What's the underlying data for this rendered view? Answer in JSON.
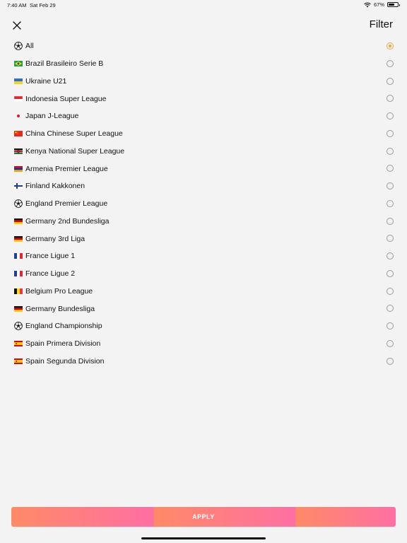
{
  "status_bar": {
    "time": "7:40 AM",
    "date": "Sat Feb 29",
    "battery_text": "67%",
    "battery_level": 0.67
  },
  "header": {
    "title": "Filter",
    "close_icon": "close-icon"
  },
  "leagues": [
    {
      "label": "All",
      "icon": "soccer-ball",
      "selected": true
    },
    {
      "label": "Brazil Brasileiro Serie B",
      "icon": "flag-brazil",
      "selected": false
    },
    {
      "label": "Ukraine U21",
      "icon": "flag-ukraine",
      "selected": false
    },
    {
      "label": "Indonesia Super League",
      "icon": "flag-indonesia",
      "selected": false
    },
    {
      "label": "Japan J-League",
      "icon": "flag-japan",
      "selected": false
    },
    {
      "label": "China Chinese Super League",
      "icon": "flag-china",
      "selected": false
    },
    {
      "label": "Kenya National Super League",
      "icon": "flag-kenya",
      "selected": false
    },
    {
      "label": "Armenia Premier League",
      "icon": "flag-armenia",
      "selected": false
    },
    {
      "label": "Finland Kakkonen",
      "icon": "flag-finland",
      "selected": false
    },
    {
      "label": "England Premier League",
      "icon": "soccer-ball",
      "selected": false
    },
    {
      "label": "Germany 2nd Bundesliga",
      "icon": "flag-germany",
      "selected": false
    },
    {
      "label": "Germany 3rd Liga",
      "icon": "flag-germany",
      "selected": false
    },
    {
      "label": "France Ligue 1",
      "icon": "flag-france",
      "selected": false
    },
    {
      "label": "France Ligue 2",
      "icon": "flag-france",
      "selected": false
    },
    {
      "label": "Belgium Pro League",
      "icon": "flag-belgium",
      "selected": false
    },
    {
      "label": "Germany Bundesliga",
      "icon": "flag-germany",
      "selected": false
    },
    {
      "label": "England Championship",
      "icon": "soccer-ball",
      "selected": false
    },
    {
      "label": "Spain Primera Division",
      "icon": "flag-spain",
      "selected": false
    },
    {
      "label": "Spain Segunda Division",
      "icon": "flag-spain",
      "selected": false
    }
  ],
  "apply_button": {
    "label": "APPLY"
  },
  "colors": {
    "accent": "#f2a33c",
    "button_start": "#ff8a66",
    "button_end": "#ff6fa3",
    "background": "#f3f3f3"
  }
}
